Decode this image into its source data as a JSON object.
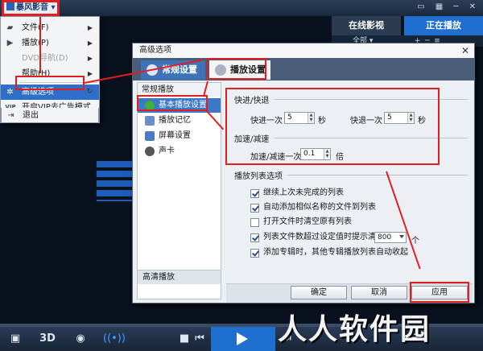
{
  "app": {
    "title": "暴风影音"
  },
  "online_tabs": [
    "在线影视",
    "正在播放"
  ],
  "playlist_bar": {
    "all_label": "全部"
  },
  "context_menu": {
    "items": [
      {
        "label": "文件(F)",
        "icon": "folder-icon",
        "submenu": true,
        "disabled": false
      },
      {
        "label": "播放(P)",
        "icon": "play-icon",
        "submenu": true,
        "disabled": false
      },
      {
        "label": "DVD导航(D)",
        "icon": "",
        "submenu": true,
        "disabled": true
      },
      {
        "label": "帮助(H)",
        "icon": "",
        "submenu": true,
        "disabled": false
      },
      {
        "label": "高级选项",
        "icon": "gear-icon",
        "submenu": false,
        "disabled": false,
        "highlight": true
      },
      {
        "label": "开启VIP去广告模式",
        "icon": "vip-icon",
        "submenu": false,
        "disabled": false
      },
      {
        "label": "退出",
        "icon": "exit-icon",
        "submenu": false,
        "disabled": false
      }
    ],
    "vip_badge": "VIP"
  },
  "dialog": {
    "title": "高级选项",
    "close": "✕",
    "tabs": {
      "general": "常规设置",
      "playback": "播放设置"
    },
    "sidebar": {
      "header": "常规播放",
      "items": [
        "基本播放设置",
        "播放记忆",
        "屏幕设置",
        "声卡"
      ],
      "footer": "高清播放"
    },
    "speed": {
      "group": "快进/快退",
      "forward_label": "快进一次",
      "forward_value": "5",
      "backward_label": "快退一次",
      "backward_value": "5",
      "unit": "秒"
    },
    "accel": {
      "group": "加速/减速",
      "label": "加速/减速一次",
      "value": "0.1",
      "unit": "倍"
    },
    "playlist": {
      "group": "播放列表选项",
      "options": [
        {
          "label": "继续上次未完成的列表",
          "checked": true
        },
        {
          "label": "自动添加相似名称的文件到列表",
          "checked": true
        },
        {
          "label": "打开文件时清空原有列表",
          "checked": false
        },
        {
          "label": "列表文件数超过设定值时提示清理",
          "checked": true
        },
        {
          "label": "添加专辑时，其他专辑播放列表自动收起",
          "checked": true
        }
      ],
      "limit_value": "800",
      "limit_unit": "个"
    },
    "buttons": {
      "ok": "确定",
      "cancel": "取消",
      "apply": "应用"
    }
  },
  "bottom_bar": {
    "label_3d": "3D"
  },
  "watermark": "人人软件园",
  "colors": {
    "accent": "#1f6fd1",
    "annotation": "#e0201e",
    "menu_highlight": "#2f6fc9"
  }
}
